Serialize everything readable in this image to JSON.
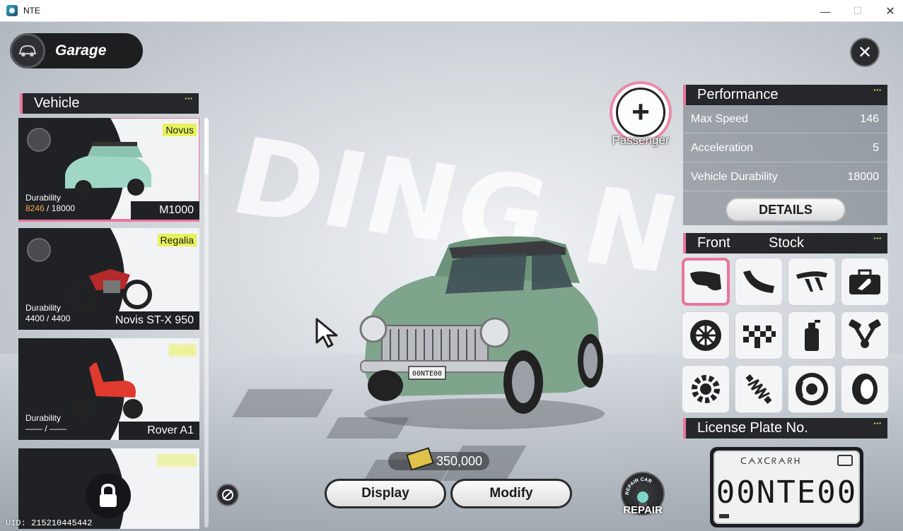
{
  "window": {
    "title": "NTE",
    "minimize": "—",
    "maximize": "☐",
    "close": "✕"
  },
  "garage": {
    "title": "Garage",
    "close": "✕"
  },
  "background_text": "DING N",
  "vehicle_section": {
    "title": "Vehicle",
    "dots": "▪▪▪"
  },
  "vehicles": [
    {
      "brand": "Novus",
      "durability_label": "Durability",
      "durability_current": "8246",
      "durability_sep": " / ",
      "durability_max": "18000",
      "name": "M1000",
      "selected": true
    },
    {
      "brand": "Regalia",
      "durability_label": "Durability",
      "durability_value": "4400 / 4400",
      "name": "Novis ST-X 950",
      "selected": false
    },
    {
      "brand": "Echo",
      "durability_label": "Durability",
      "durability_value": "—— / ——",
      "name": "Rover A1",
      "selected": false
    },
    {
      "locked": true
    }
  ],
  "passenger": {
    "label": "Passenger",
    "icon": "+"
  },
  "performance": {
    "title": "Performance",
    "rows": [
      {
        "label": "Max Speed",
        "value": "146"
      },
      {
        "label": "Acceleration",
        "value": "5"
      },
      {
        "label": "Vehicle Durability",
        "value": "18000"
      }
    ],
    "details_label": "DETAILS"
  },
  "parts": {
    "title": "Front",
    "subtitle": "Stock",
    "items": [
      {
        "icon": "front-bumper-icon",
        "selected": true
      },
      {
        "icon": "side-skirt-icon"
      },
      {
        "icon": "spoiler-icon"
      },
      {
        "icon": "toolbox-icon"
      },
      {
        "icon": "wheel-rim-icon"
      },
      {
        "icon": "checkered-flag-icon"
      },
      {
        "icon": "spray-paint-icon"
      },
      {
        "icon": "engine-piston-icon"
      },
      {
        "icon": "gear-transmission-icon"
      },
      {
        "icon": "suspension-spring-icon"
      },
      {
        "icon": "brake-disc-icon"
      },
      {
        "icon": "tire-icon"
      }
    ]
  },
  "license_plate": {
    "title": "License Plate No.",
    "script_text": "ᑕᗅXᑕᖇᗅᖇᕼ",
    "number": "00NTE00"
  },
  "currency": {
    "amount": "350,000"
  },
  "buttons": {
    "display": "Display",
    "modify": "Modify"
  },
  "repair": {
    "label": "REPAIR",
    "arc_text": "REPAIR CAR"
  },
  "uid": "UID: 215210445442",
  "car_plate": "00NTE00"
}
